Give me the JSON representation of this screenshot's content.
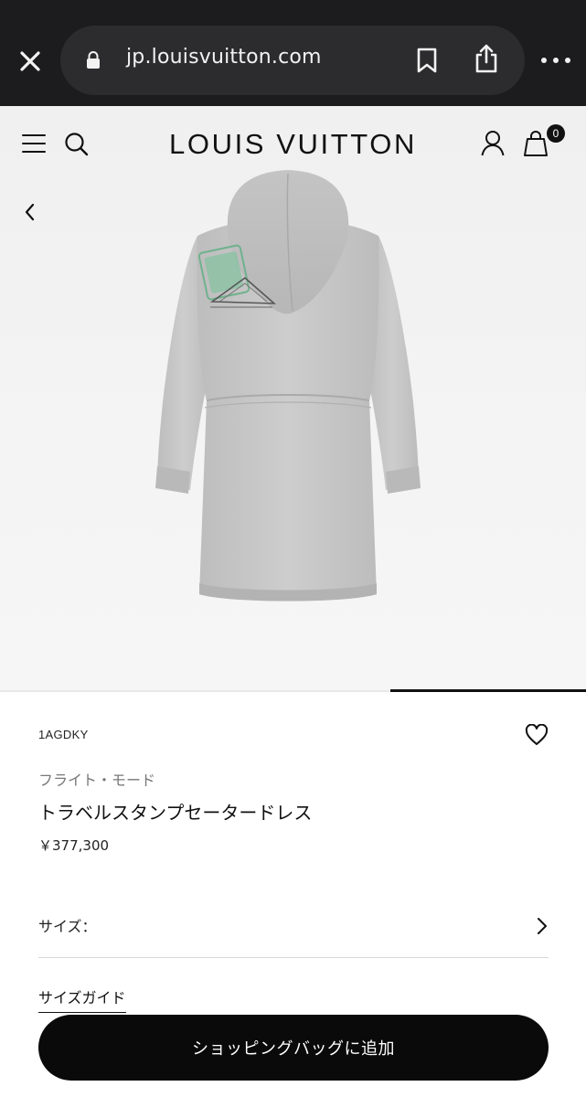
{
  "browser": {
    "url": "jp.louisvuitton.com"
  },
  "header": {
    "brand": "LOUIS VUITTON",
    "bag_count": "0"
  },
  "product": {
    "sku": "1AGDKY",
    "collection": "フライト・モード",
    "name": "トラベルスタンプセータードレス",
    "price": "￥377,300",
    "size_label": "サイズ：",
    "size_guide": "サイズガイド",
    "add_to_bag": "ショッピングバッグに追加"
  },
  "carousel": {
    "active_index": 3,
    "total": 3
  },
  "icons": {
    "close": "close-icon",
    "lock": "lock-icon",
    "bookmark": "bookmark-icon",
    "share": "share-icon",
    "more": "more-icon",
    "menu": "menu-icon",
    "search": "search-icon",
    "account": "account-icon",
    "bag": "shopping-bag-icon",
    "back": "chevron-left-icon",
    "wishlist": "heart-icon",
    "size_arrow": "chevron-right-icon"
  },
  "colors": {
    "browser_bar": "#1c1c1e",
    "url_pill": "#2c2c2e",
    "button": "#0a0a0a",
    "hero_bg": "#f2f2f2",
    "garment": "#c9c9c9",
    "stamp_green": "#6fb28e"
  }
}
